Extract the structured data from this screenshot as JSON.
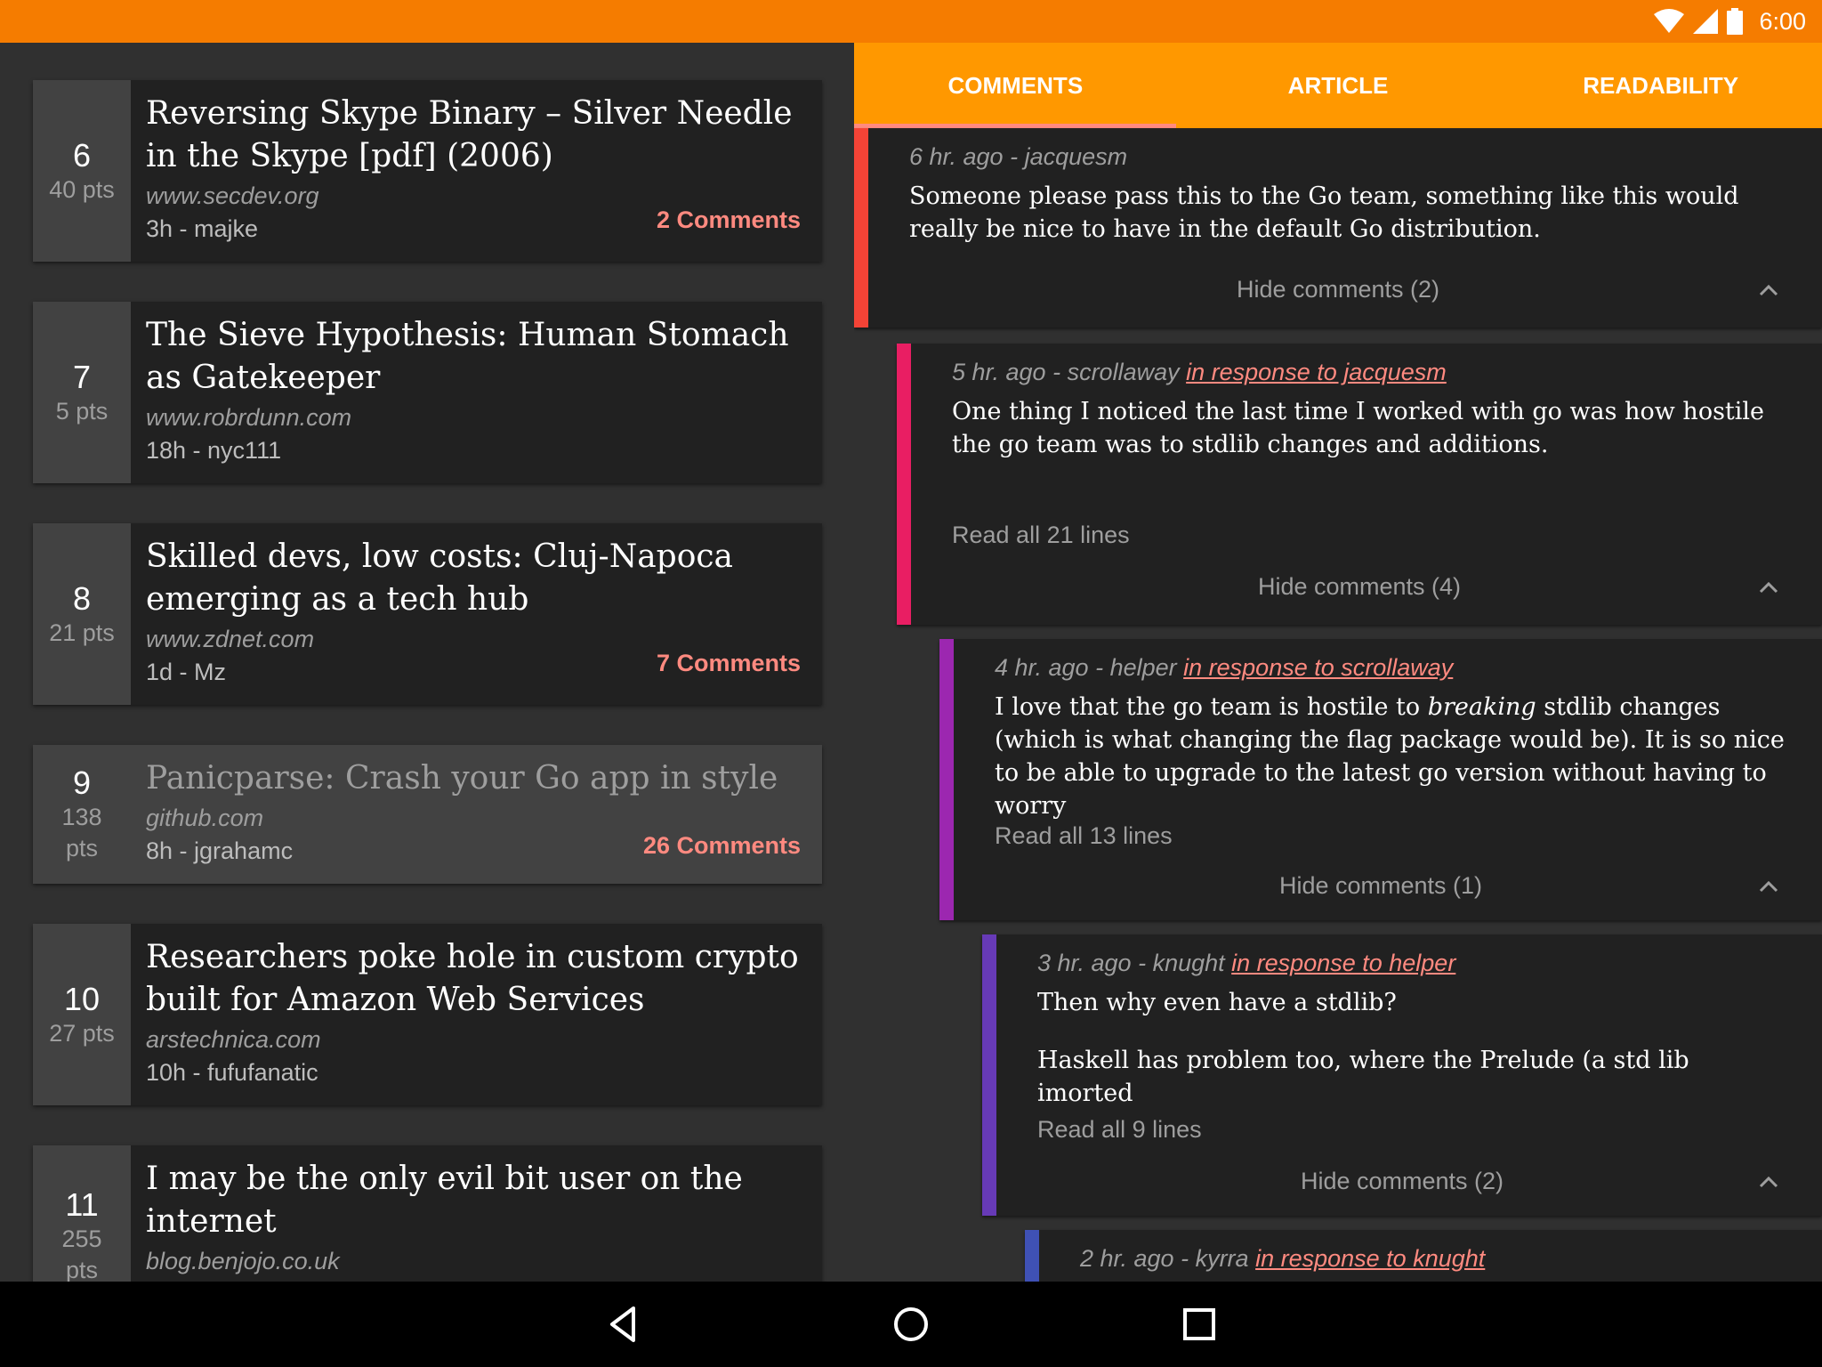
{
  "status": {
    "time": "6:00"
  },
  "stories": [
    {
      "rank": "6",
      "points": "40 pts",
      "title": "Reversing Skype Binary – Silver Needle in the Skype [pdf] (2006)",
      "domain": "www.secdev.org",
      "meta": "3h - majke",
      "comments": "2 Comments"
    },
    {
      "rank": "7",
      "points": "5 pts",
      "title": "The Sieve Hypothesis: Human Stomach as Gatekeeper",
      "domain": "www.robrdunn.com",
      "meta": "18h - nyc111",
      "comments": ""
    },
    {
      "rank": "8",
      "points": "21 pts",
      "title": "Skilled devs, low costs: Cluj-Napoca emerging as a tech hub",
      "domain": "www.zdnet.com",
      "meta": "1d - Mz",
      "comments": "7 Comments"
    },
    {
      "rank": "9",
      "points": "138 pts",
      "title": "Panicparse: Crash your Go app in style",
      "domain": "github.com",
      "meta": "8h - jgrahamc",
      "comments": "26 Comments"
    },
    {
      "rank": "10",
      "points": "27 pts",
      "title": "Researchers poke hole in custom crypto built for Amazon Web Services",
      "domain": "arstechnica.com",
      "meta": "10h - fufufanatic",
      "comments": ""
    },
    {
      "rank": "11",
      "points": "255 pts",
      "title": "I may be the only evil bit user on the internet",
      "domain": "blog.benjojo.co.uk",
      "meta": "",
      "comments": ""
    }
  ],
  "tabs": [
    "COMMENTS",
    "ARTICLE",
    "READABILITY"
  ],
  "comments": [
    {
      "head": "6 hr. ago - jacquesm",
      "reply": "",
      "text": "Someone please pass this to the Go team, something like this would really be nice to have in the default Go distribution.",
      "read_all": "",
      "hide": "Hide comments (2)",
      "color": "#f44336"
    },
    {
      "head": "5 hr. ago - scrollaway",
      "reply": "in response to jacquesm",
      "text": "One thing I noticed the last time I worked with go was how hostile the go team was to stdlib changes and additions.",
      "read_all": "Read all 21 lines",
      "hide": "Hide comments (4)",
      "color": "#e91e63"
    },
    {
      "head": "4 hr. ago - helper",
      "reply": "in response to scrollaway",
      "text_a": "I love that the go team is hostile to ",
      "text_em": "breaking",
      "text_b": " stdlib changes (which is what changing the flag package would be). It is so nice to be able to upgrade to the latest go version without having to worry",
      "read_all": "Read all 13 lines",
      "hide": "Hide comments (1)",
      "color": "#9c27b0"
    },
    {
      "head": "3 hr. ago - knught",
      "reply": "in response to helper",
      "text": "Then why even have a stdlib?",
      "text2": "Haskell has problem too, where the Prelude (a std lib imorted",
      "read_all": "Read all 9 lines",
      "hide": "Hide comments (2)",
      "color": "#673ab7"
    },
    {
      "head": "2 hr. ago - kyrra",
      "reply": "in response to knught",
      "color": "#3f51b5"
    }
  ]
}
